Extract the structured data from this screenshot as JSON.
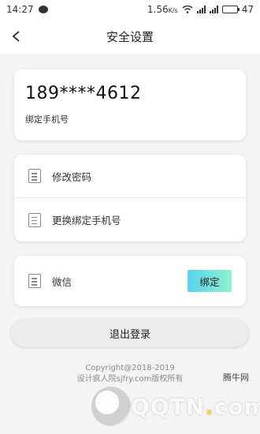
{
  "status_bar": {
    "time": "14:27",
    "speed": "1.56",
    "speed_unit": "K/s",
    "battery_level": "47"
  },
  "nav": {
    "title": "安全设置"
  },
  "phone_card": {
    "number": "189****4612",
    "caption": "绑定手机号"
  },
  "menu": {
    "items": [
      {
        "label": "修改密码"
      },
      {
        "label": "更换绑定手机号"
      }
    ]
  },
  "wechat": {
    "label": "微信",
    "bind_label": "绑定"
  },
  "logout_label": "退出登录",
  "footer": {
    "line1": "Copyright@2018-2019",
    "line2": "设计疯人院sjfry.com版权所有"
  },
  "watermark": {
    "brand": "腾牛网",
    "text_part1": "QQTN",
    "text_dot": ".",
    "text_part2": "com"
  },
  "colors": {
    "bind_gradient_start": "#5ad3ee",
    "bind_gradient_end": "#8ff0ce"
  }
}
